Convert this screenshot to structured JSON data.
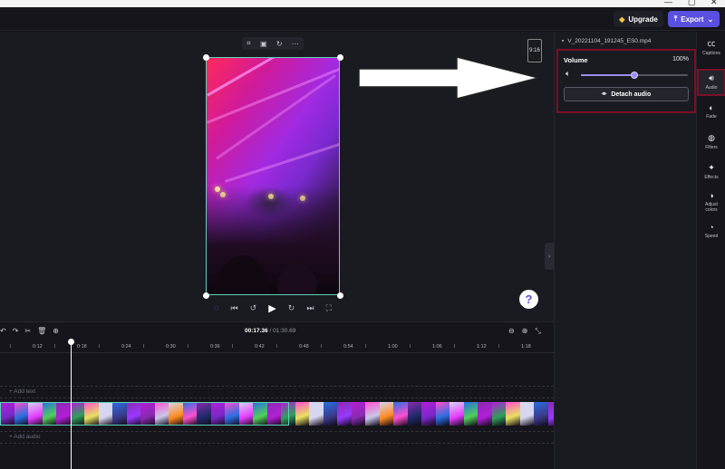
{
  "window": {
    "controls": [
      "—",
      "▢",
      "✕"
    ]
  },
  "header": {
    "upgrade_label": "Upgrade",
    "export_label": "Export"
  },
  "preview": {
    "aspect_ratio": "9:16",
    "toolbar_icons": [
      "crop-icon",
      "fit-icon",
      "rotate-icon",
      "more-icon"
    ],
    "help_label": "?"
  },
  "playback": {
    "current_time": "00:17.36",
    "separator": " / ",
    "duration": "01:30.69"
  },
  "properties": {
    "file_name": "V_20221104_191245_ES0.mp4",
    "volume_label": "Volume",
    "volume_value": "100%",
    "volume_level": 0.5,
    "detach_label": "Detach audio"
  },
  "rail": {
    "items": [
      {
        "label": "Captions",
        "icon": "captions-icon"
      },
      {
        "label": "Audio",
        "icon": "speaker-icon",
        "active": true
      },
      {
        "label": "Fade",
        "icon": "fade-icon"
      },
      {
        "label": "Filters",
        "icon": "filters-icon"
      },
      {
        "label": "Effects",
        "icon": "effects-icon"
      },
      {
        "label": "Adjust colors",
        "icon": "adjust-colors-icon"
      },
      {
        "label": "Speed",
        "icon": "speed-icon"
      }
    ]
  },
  "timeline": {
    "ticks": [
      "0:12",
      "0:18",
      "0:24",
      "0:30",
      "0:36",
      "0:42",
      "0:48",
      "0:54",
      "1:00",
      "1:06",
      "1:12",
      "1:18"
    ],
    "add_text_label": "+ Add text",
    "add_audio_label": "+ Add audio"
  },
  "colors": {
    "accent": "#5b4fe0",
    "selection": "#5fd1b8",
    "highlight_box": "#7a1026"
  }
}
